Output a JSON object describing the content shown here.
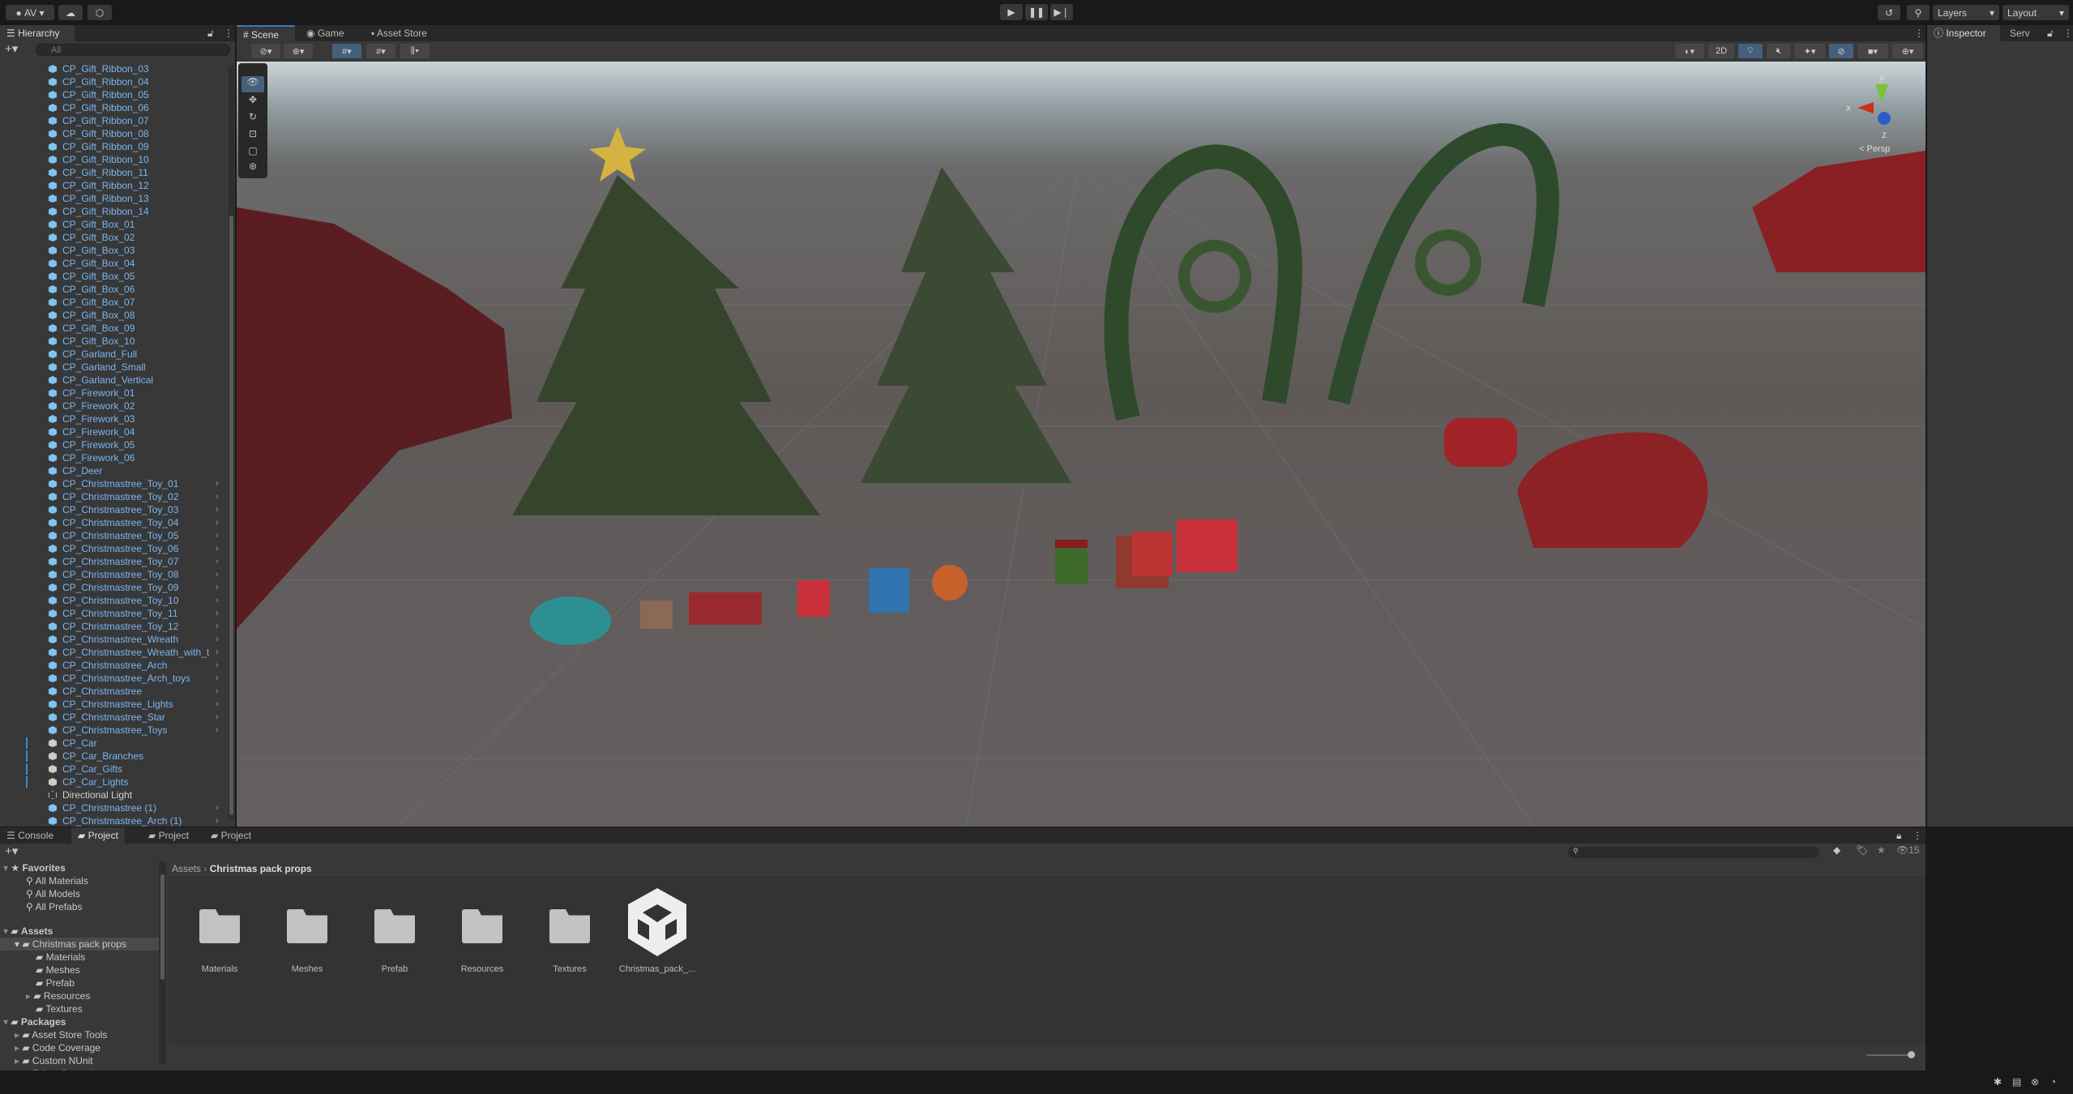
{
  "toolbar": {
    "account": "AV",
    "layers": "Layers",
    "layout": "Layout"
  },
  "hierarchy": {
    "title": "Hierarchy",
    "search_placeholder": "All",
    "items": [
      {
        "n": "CP_Gift_Ribbon_03"
      },
      {
        "n": "CP_Gift_Ribbon_04"
      },
      {
        "n": "CP_Gift_Ribbon_05"
      },
      {
        "n": "CP_Gift_Ribbon_06"
      },
      {
        "n": "CP_Gift_Ribbon_07"
      },
      {
        "n": "CP_Gift_Ribbon_08"
      },
      {
        "n": "CP_Gift_Ribbon_09"
      },
      {
        "n": "CP_Gift_Ribbon_10"
      },
      {
        "n": "CP_Gift_Ribbon_11"
      },
      {
        "n": "CP_Gift_Ribbon_12"
      },
      {
        "n": "CP_Gift_Ribbon_13"
      },
      {
        "n": "CP_Gift_Ribbon_14"
      },
      {
        "n": "CP_Gift_Box_01"
      },
      {
        "n": "CP_Gift_Box_02"
      },
      {
        "n": "CP_Gift_Box_03"
      },
      {
        "n": "CP_Gift_Box_04"
      },
      {
        "n": "CP_Gift_Box_05"
      },
      {
        "n": "CP_Gift_Box_06"
      },
      {
        "n": "CP_Gift_Box_07"
      },
      {
        "n": "CP_Gift_Box_08"
      },
      {
        "n": "CP_Gift_Box_09"
      },
      {
        "n": "CP_Gift_Box_10"
      },
      {
        "n": "CP_Garland_Full"
      },
      {
        "n": "CP_Garland_Small"
      },
      {
        "n": "CP_Garland_Vertical"
      },
      {
        "n": "CP_Firework_01"
      },
      {
        "n": "CP_Firework_02"
      },
      {
        "n": "CP_Firework_03"
      },
      {
        "n": "CP_Firework_04"
      },
      {
        "n": "CP_Firework_05"
      },
      {
        "n": "CP_Firework_06"
      },
      {
        "n": "CP_Deer"
      },
      {
        "n": "CP_Christmastree_Toy_01",
        "c": 1
      },
      {
        "n": "CP_Christmastree_Toy_02",
        "c": 1
      },
      {
        "n": "CP_Christmastree_Toy_03",
        "c": 1
      },
      {
        "n": "CP_Christmastree_Toy_04",
        "c": 1
      },
      {
        "n": "CP_Christmastree_Toy_05",
        "c": 1
      },
      {
        "n": "CP_Christmastree_Toy_06",
        "c": 1
      },
      {
        "n": "CP_Christmastree_Toy_07",
        "c": 1
      },
      {
        "n": "CP_Christmastree_Toy_08",
        "c": 1
      },
      {
        "n": "CP_Christmastree_Toy_09",
        "c": 1
      },
      {
        "n": "CP_Christmastree_Toy_10",
        "c": 1
      },
      {
        "n": "CP_Christmastree_Toy_11",
        "c": 1
      },
      {
        "n": "CP_Christmastree_Toy_12",
        "c": 1
      },
      {
        "n": "CP_Christmastree_Wreath",
        "c": 1
      },
      {
        "n": "CP_Christmastree_Wreath_with_t",
        "c": 1
      },
      {
        "n": "CP_Christmastree_Arch",
        "c": 1
      },
      {
        "n": "CP_Christmastree_Arch_toys",
        "c": 1
      },
      {
        "n": "CP_Christmastree",
        "c": 1
      },
      {
        "n": "CP_Christmastree_Lights",
        "c": 1
      },
      {
        "n": "CP_Christmastree_Star",
        "c": 1
      },
      {
        "n": "CP_Christmastree_Toys",
        "c": 1
      },
      {
        "n": "CP_Car",
        "m": 1,
        "g": 1
      },
      {
        "n": "CP_Car_Branches",
        "m": 1,
        "g": 1
      },
      {
        "n": "CP_Car_Gifts",
        "m": 1,
        "g": 1
      },
      {
        "n": "CP_Car_Lights",
        "m": 1,
        "g": 1
      },
      {
        "n": "Directional Light",
        "w": 1
      },
      {
        "n": "CP_Christmastree (1)",
        "c": 1
      },
      {
        "n": "CP_Christmastree_Arch (1)",
        "c": 1
      }
    ]
  },
  "scene_tabs": [
    "Scene",
    "Game",
    "Asset Store"
  ],
  "scene_toolbar": {
    "mode_2d": "2D"
  },
  "gizmo": {
    "x": "x",
    "y": "y",
    "z": "z",
    "persp": "Persp"
  },
  "inspector": {
    "tabs": [
      "Inspector",
      "Serv"
    ]
  },
  "bottom_tabs": [
    "Console",
    "Project",
    "Project",
    "Project"
  ],
  "project": {
    "breadcrumb": [
      "Assets",
      "Christmas pack props"
    ],
    "favorites": {
      "label": "Favorites",
      "items": [
        "All Materials",
        "All Models",
        "All Prefabs"
      ]
    },
    "assets": {
      "label": "Assets",
      "selected": "Christmas pack props",
      "children": [
        "Materials",
        "Meshes",
        "Prefab",
        "Resources",
        "Textures"
      ]
    },
    "packages": {
      "label": "Packages",
      "items": [
        "Asset Store Tools",
        "Code Coverage",
        "Custom NUnit",
        "Editor Coroutines"
      ]
    },
    "grid": [
      "Materials",
      "Meshes",
      "Prefab",
      "Resources",
      "Textures",
      "Christmas_pack_..."
    ],
    "hidden_count": "15"
  },
  "colors": {
    "accent": "#3a79bb",
    "prefab_text": "#7ab6f0"
  }
}
